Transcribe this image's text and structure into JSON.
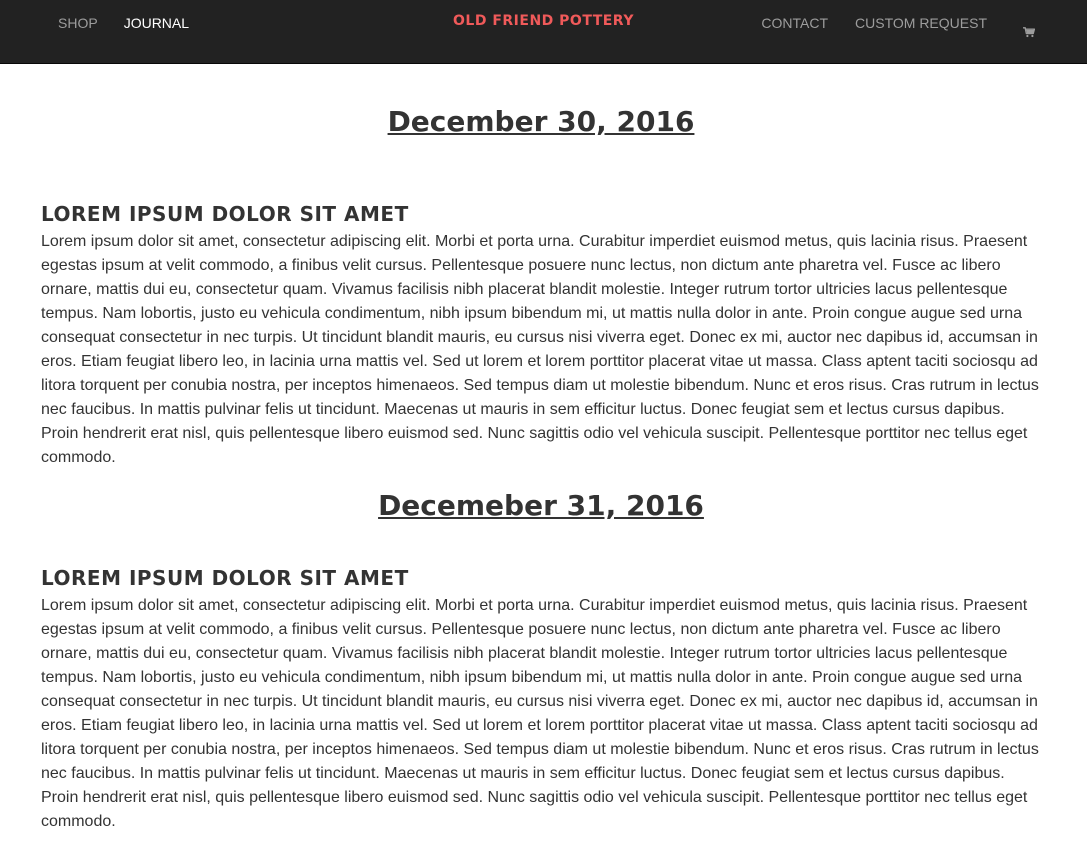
{
  "nav": {
    "left": [
      {
        "label": "SHOP",
        "active": false
      },
      {
        "label": "JOURNAL",
        "active": true
      }
    ],
    "brand": "Old Friend Pottery",
    "right": [
      {
        "label": "CONTACT"
      },
      {
        "label": "CUSTOM REQUEST"
      }
    ],
    "cart_icon": "shopping-cart-icon"
  },
  "colors": {
    "navbar_bg": "#222222",
    "nav_text": "#9d9d9d",
    "nav_active": "#ffffff",
    "brand": "#f05a5a",
    "body_text": "#333333"
  },
  "entries": [
    {
      "date": "December 30, 2016",
      "title": "Lorem ipsum dolor sit amet",
      "body": "Lorem ipsum dolor sit amet, consectetur adipiscing elit. Morbi et porta urna. Curabitur imperdiet euismod metus, quis lacinia risus. Praesent egestas ipsum at velit commodo, a finibus velit cursus. Pellentesque posuere nunc lectus, non dictum ante pharetra vel. Fusce ac libero ornare, mattis dui eu, consectetur quam. Vivamus facilisis nibh placerat blandit molestie. Integer rutrum tortor ultricies lacus pellentesque tempus. Nam lobortis, justo eu vehicula condimentum, nibh ipsum bibendum mi, ut mattis nulla dolor in ante. Proin congue augue sed urna consequat consectetur in nec turpis. Ut tincidunt blandit mauris, eu cursus nisi viverra eget. Donec ex mi, auctor nec dapibus id, accumsan in eros. Etiam feugiat libero leo, in lacinia urna mattis vel. Sed ut lorem et lorem porttitor placerat vitae ut massa. Class aptent taciti sociosqu ad litora torquent per conubia nostra, per inceptos himenaeos. Sed tempus diam ut molestie bibendum. Nunc et eros risus. Cras rutrum in lectus nec faucibus. In mattis pulvinar felis ut tincidunt. Maecenas ut mauris in sem efficitur luctus. Donec feugiat sem et lectus cursus dapibus. Proin hendrerit erat nisl, quis pellentesque libero euismod sed. Nunc sagittis odio vel vehicula suscipit. Pellentesque porttitor nec tellus eget commodo."
    },
    {
      "date": "Decemeber 31, 2016",
      "title": "Lorem ipsum dolor sit amet",
      "body": "Lorem ipsum dolor sit amet, consectetur adipiscing elit. Morbi et porta urna. Curabitur imperdiet euismod metus, quis lacinia risus. Praesent egestas ipsum at velit commodo, a finibus velit cursus. Pellentesque posuere nunc lectus, non dictum ante pharetra vel. Fusce ac libero ornare, mattis dui eu, consectetur quam. Vivamus facilisis nibh placerat blandit molestie. Integer rutrum tortor ultricies lacus pellentesque tempus. Nam lobortis, justo eu vehicula condimentum, nibh ipsum bibendum mi, ut mattis nulla dolor in ante. Proin congue augue sed urna consequat consectetur in nec turpis. Ut tincidunt blandit mauris, eu cursus nisi viverra eget. Donec ex mi, auctor nec dapibus id, accumsan in eros. Etiam feugiat libero leo, in lacinia urna mattis vel. Sed ut lorem et lorem porttitor placerat vitae ut massa. Class aptent taciti sociosqu ad litora torquent per conubia nostra, per inceptos himenaeos. Sed tempus diam ut molestie bibendum. Nunc et eros risus. Cras rutrum in lectus nec faucibus. In mattis pulvinar felis ut tincidunt. Maecenas ut mauris in sem efficitur luctus. Donec feugiat sem et lectus cursus dapibus. Proin hendrerit erat nisl, quis pellentesque libero euismod sed. Nunc sagittis odio vel vehicula suscipit. Pellentesque porttitor nec tellus eget commodo."
    }
  ]
}
